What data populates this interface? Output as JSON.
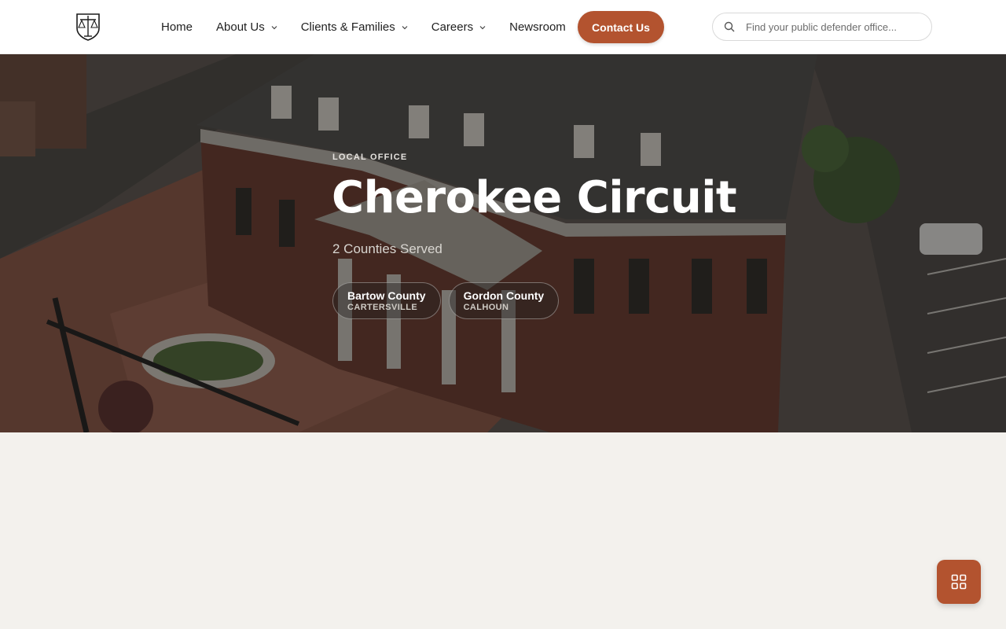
{
  "header": {
    "logo_name": "scales-of-justice-logo",
    "nav": [
      {
        "label": "Home",
        "has_dropdown": false
      },
      {
        "label": "About Us",
        "has_dropdown": true
      },
      {
        "label": "Clients & Families",
        "has_dropdown": true
      },
      {
        "label": "Careers",
        "has_dropdown": true
      },
      {
        "label": "Newsroom",
        "has_dropdown": false
      }
    ],
    "contact_label": "Contact Us",
    "search": {
      "placeholder": "Find your public defender office...",
      "value": ""
    }
  },
  "hero": {
    "eyebrow": "LOCAL OFFICE",
    "title": "Cherokee Circuit",
    "subtitle": "2 Counties Served",
    "counties": [
      {
        "name": "Bartow County",
        "city": "CARTERSVILLE"
      },
      {
        "name": "Gordon County",
        "city": "CALHOUN"
      }
    ]
  },
  "fab": {
    "icon": "grid-icon"
  },
  "colors": {
    "accent": "#b3532f",
    "page_bg": "#f3f1ed",
    "header_bg": "#ffffff"
  }
}
